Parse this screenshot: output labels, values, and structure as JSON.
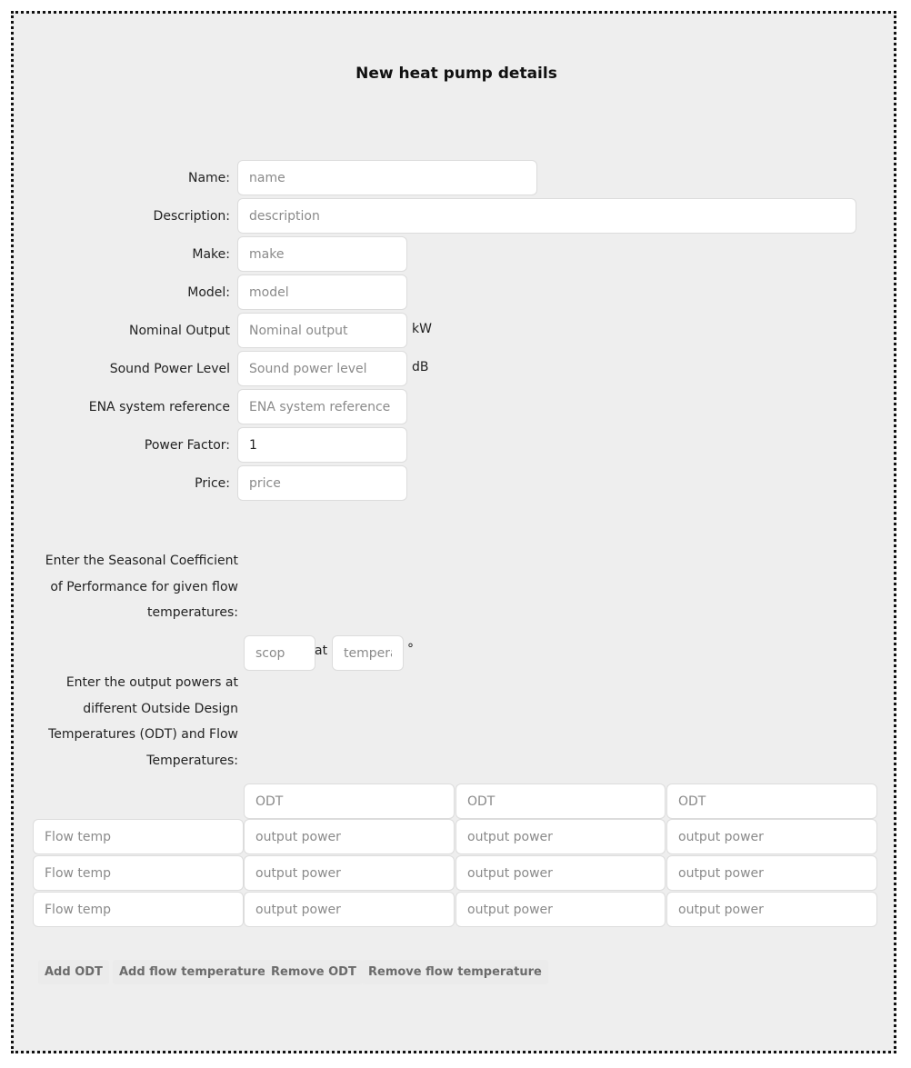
{
  "title": "New heat pump details",
  "fields": {
    "name": {
      "label": "Name:",
      "placeholder": "name",
      "value": ""
    },
    "description": {
      "label": "Description:",
      "placeholder": "description",
      "value": ""
    },
    "make": {
      "label": "Make:",
      "placeholder": "make",
      "value": ""
    },
    "model": {
      "label": "Model:",
      "placeholder": "model",
      "value": ""
    },
    "nominal_output": {
      "label": "Nominal Output",
      "placeholder": "Nominal output",
      "value": "",
      "unit": "kW"
    },
    "sound_power_level": {
      "label": "Sound Power Level",
      "placeholder": "Sound power level",
      "value": "",
      "unit": "dB"
    },
    "ena_reference": {
      "label": "ENA system reference",
      "placeholder": "ENA system reference",
      "value": ""
    },
    "power_factor": {
      "label": "Power Factor:",
      "placeholder": "",
      "value": "1"
    },
    "price": {
      "label": "Price:",
      "placeholder": "price",
      "value": ""
    }
  },
  "scop": {
    "prompt": "Enter the Seasonal Coefficient of Performance for given flow temperatures:",
    "scop_placeholder": "scop",
    "at_label": "at",
    "temperature_placeholder": "temperature",
    "degree": "°"
  },
  "output_powers": {
    "prompt": "Enter the output powers at different Outside Design Temperatures (ODT) and Flow Temperatures:",
    "odt_placeholder": "ODT",
    "flow_placeholder": "Flow temp",
    "power_placeholder": "output power"
  },
  "buttons": {
    "add_odt": "Add ODT",
    "add_flow": "Add flow temperature",
    "remove_odt": "Remove ODT",
    "remove_flow": "Remove flow temperature"
  }
}
